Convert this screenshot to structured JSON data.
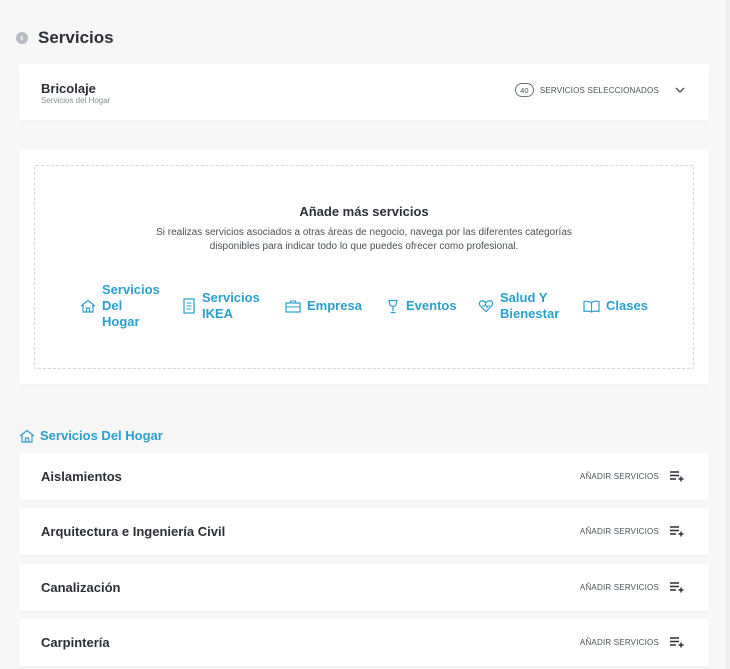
{
  "header": {
    "title": "Servicios"
  },
  "selected": {
    "title": "Bricolaje",
    "subtitle": "Servicios del Hogar",
    "count": "40",
    "label": "SERVICIOS SELECCIONADOS"
  },
  "add_more": {
    "title": "Añade más servicios",
    "description": "Si realizas servicios asociados a otras áreas de negocio, navega por las diferentes categorías disponibles para indicar todo lo que puedes ofrecer como profesional.",
    "categories": [
      {
        "label": "Servicios Del Hogar",
        "icon": "house-icon"
      },
      {
        "label": "Servicios IKEA",
        "icon": "document-icon"
      },
      {
        "label": "Empresa",
        "icon": "briefcase-icon"
      },
      {
        "label": "Eventos",
        "icon": "trophy-icon"
      },
      {
        "label": "Salud Y Bienestar",
        "icon": "heart-icon"
      },
      {
        "label": "Clases",
        "icon": "book-icon"
      }
    ]
  },
  "section": {
    "title": "Servicios Del Hogar",
    "action_label": "AÑADIR SERVICIOS",
    "rows": [
      {
        "title": "Aislamientos"
      },
      {
        "title": "Arquitectura e Ingeniería Civil"
      },
      {
        "title": "Canalización"
      },
      {
        "title": "Carpintería"
      }
    ]
  },
  "colors": {
    "accent": "#2aa0cc",
    "text": "#2b2f36",
    "background": "#f7f7f8"
  }
}
